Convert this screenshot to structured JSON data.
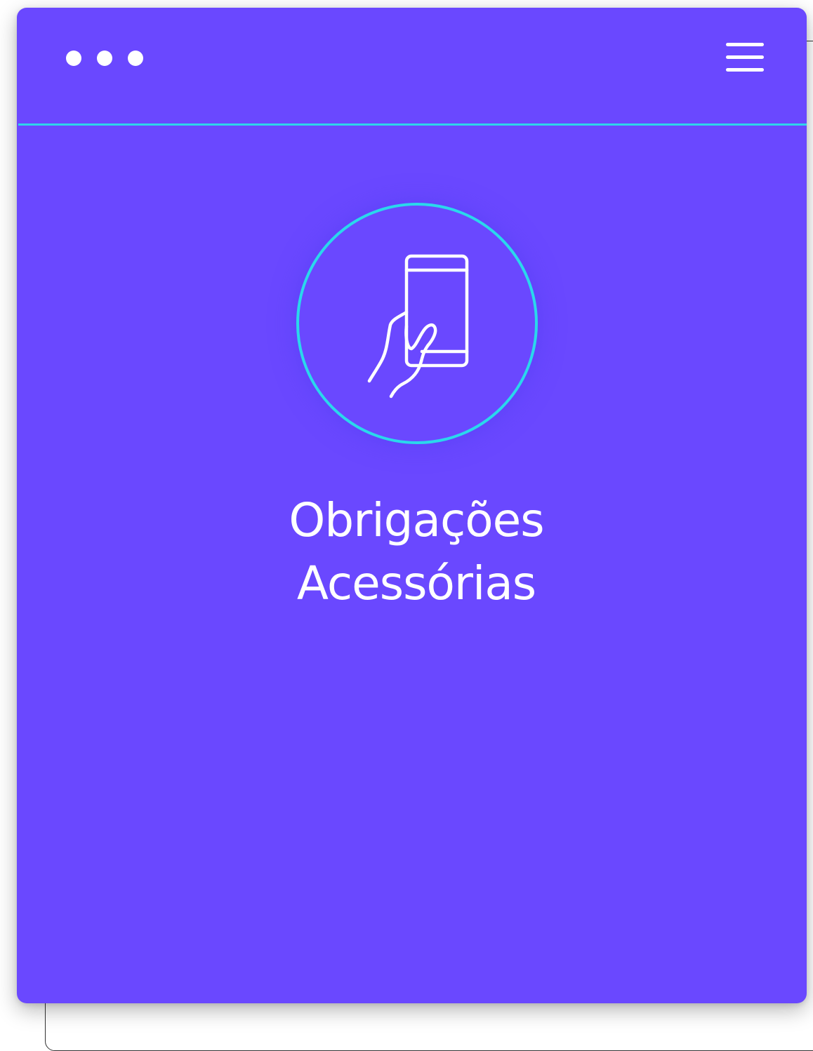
{
  "title": {
    "line1": "Obrigações",
    "line2": "Acessórias"
  },
  "icons": {
    "window_dots": "more-dots-icon",
    "menu": "hamburger-menu-icon",
    "feature": "hand-holding-phone-icon"
  },
  "colors": {
    "card_background": "#6a48ff",
    "accent": "#2ad8ec",
    "text": "#ffffff"
  }
}
